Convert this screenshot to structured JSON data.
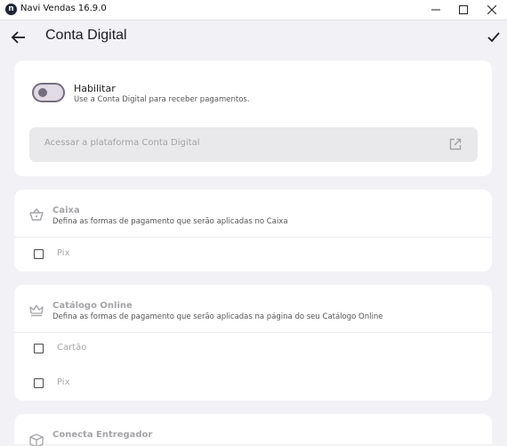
{
  "window": {
    "title": "Navi Vendas 16.9.0",
    "app_icon_letter": "n"
  },
  "appbar": {
    "title": "Conta Digital"
  },
  "conta_digital": {
    "toggle_label": "Habilitar",
    "toggle_description": "Use a Conta Digital para receber pagamentos.",
    "enabled": false,
    "platform_button": "Acessar a plataforma Conta Digital"
  },
  "sections": {
    "caixa": {
      "title": "Caixa",
      "description": "Defina as formas de pagamento que serão aplicadas no Caixa",
      "options": [
        "Pix"
      ]
    },
    "catalogo": {
      "title": "Catálogo Online",
      "description": "Defina as formas de pagamento que serão aplicadas na página do seu Catálogo Online",
      "options": [
        "Cartão",
        "Pix"
      ]
    },
    "entregador": {
      "title": "Conecta Entregador"
    }
  },
  "colors": {
    "background": "#f2f2f6",
    "card": "#ffffff",
    "muted_text": "#a4a4a8",
    "toggle_track": "#e0dbe4"
  }
}
